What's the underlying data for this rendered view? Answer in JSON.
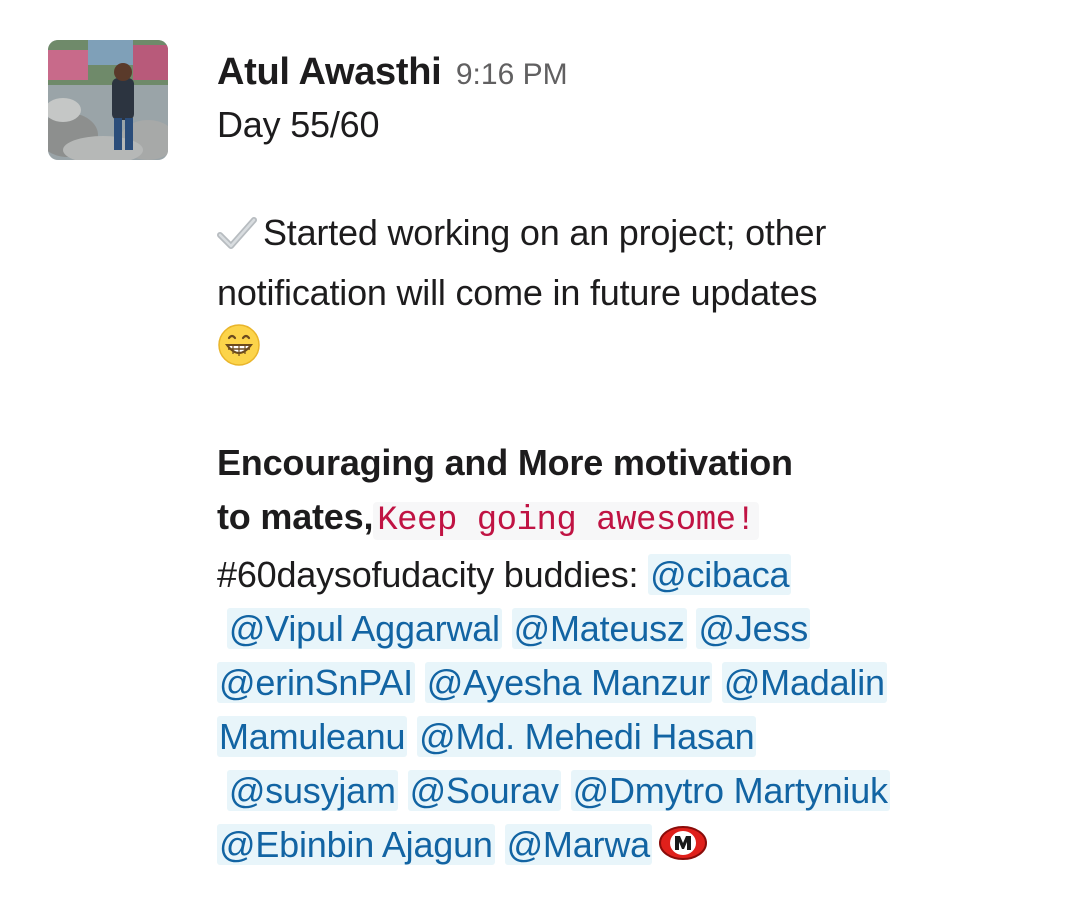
{
  "message": {
    "author": "Atul Awasthi",
    "timestamp": "9:16 PM",
    "avatar_alt": "user-avatar-photo",
    "day_line": "Day 55/60",
    "task_line_1": "Started working on an project; other",
    "task_line_2": "notification will come in future updates",
    "bold_line_1": "Encouraging and More motivation",
    "bold_line_2": "to mates,",
    "code_text": "Keep going awesome!",
    "hashtag_text": "#60daysofudacity buddies: ",
    "mentions": [
      "@cibaca",
      "@Vipul Aggarwal",
      "@Mateusz",
      "@Jess",
      "@erinSnPAI",
      "@Ayesha Manzur",
      "@Madalin",
      "Mamuleanu",
      "@Md. Mehedi Hasan",
      "@susyjam",
      "@Sourav",
      "@Dmytro Martyniuk",
      "@Ebinbin Ajagun",
      "@Marwa"
    ]
  },
  "icons": {
    "check": "heavy-check-mark-icon",
    "grin": "grinning-face-emoji",
    "badge": "m-badge-icon"
  },
  "colors": {
    "mention_text": "#1264a3",
    "mention_bg": "#e8f5fa",
    "code_text": "#c01343",
    "timestamp": "#616061"
  }
}
